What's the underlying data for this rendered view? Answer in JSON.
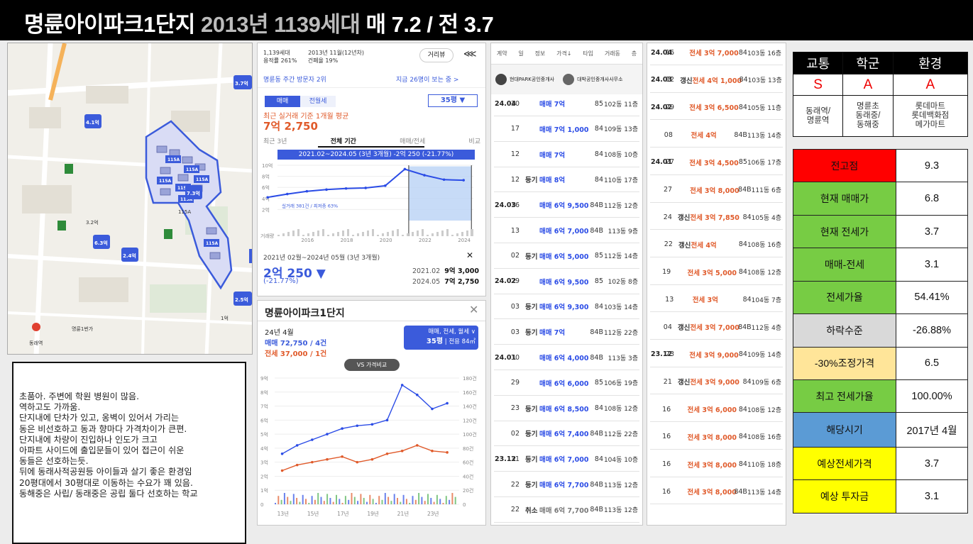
{
  "title": {
    "main": "명륜아이파크1단지",
    "sub": "2013년 1139세대",
    "rest": "매 7.2 / 전 3.7"
  },
  "map": {
    "labels": [
      "명륜1번가",
      "동래역",
      "3.2억",
      "6.3억",
      "4.1억",
      "1억",
      "2.4억",
      "115A",
      "7.3억",
      "3.7억",
      "2.5억"
    ],
    "unit_tags": [
      "115A",
      "115A",
      "115A",
      "115A",
      "115A",
      "115A",
      "115A"
    ]
  },
  "memo": [
    "초품아. 주변에 학원 병원이 많음.",
    "역하고도 가까움.",
    "단지내에 단차가 있고, 옹벽이 있어서 가리는",
    "동은 비선호하고 동과 향마다 가격차이가 큰편.",
    "단지내에 차량이 진입하나 인도가 크고",
    "아파트 사이드에 출입문들이 있어 접근이 쉬운",
    "동들은 선호하는듯.",
    "뒤에 동래사적공원등 아이들과 살기 좋은 환경임",
    "20평대에서 30평대로 이동하는 수요가 꽤 있음.",
    "동해중은 사립/ 동래중은 공립 둘다 선호하는 학교"
  ],
  "p1": {
    "households": "1,139세대",
    "built": "2013년 11월(12년차)",
    "far": "용적률 261%",
    "bcr": "건폐율 19%",
    "street_btn": "거리뷰",
    "visitor_rank": "명륜동 주간 방문자 2위",
    "viewers": "지금 26명이 보는 중 >",
    "tab_sale": "매매",
    "tab_jeonse": "전월세",
    "pyeong": "35평 ▼",
    "basis": "최근 실거래 기준 1개월 평균",
    "avg_price": "7억 2,750",
    "range_tabs": [
      "최근 3년",
      "전체 기간",
      "매매/전세",
      "비교"
    ],
    "banner": "2021.02~2024.05 (3년 3개월) -2억 250 (-21.77%)",
    "count_note": "실거래 381건 / 최저층 63%",
    "y_ticks": [
      "10억",
      "8억",
      "6억",
      "4억",
      "2억",
      "거래량"
    ],
    "x_ticks": [
      "2016",
      "2018",
      "2020",
      "2022",
      "2024"
    ],
    "period": "2021년 02월~2024년 05월 (3년 3개월)",
    "close_x": "✕",
    "change": "2억 250 ▼",
    "change_pct": "(-21.77%)",
    "start_date": "2021.02",
    "start_price": "9억 3,000",
    "end_date": "2024.05",
    "end_price": "7억 2,750"
  },
  "p2": {
    "name": "명륜아이파크1단지",
    "close": "✕",
    "month": "24년 4월",
    "sale_line": "매매 72,750 / 4건",
    "jeonse_line": "전세 37,000 / 1건",
    "filter1": "매매, 전세, 월세 ∨",
    "filter2": "35평",
    "filter3": "전용 84㎡",
    "vs": "VS 가격비교",
    "y_left": [
      "9억",
      "8억",
      "7억",
      "6억",
      "5억",
      "4억",
      "3억",
      "2억",
      "1억",
      "0"
    ],
    "y_right": [
      "180건",
      "160건",
      "140건",
      "120건",
      "100건",
      "80건",
      "60건",
      "40건",
      "20건",
      "0"
    ],
    "x_ticks": [
      "13년",
      "15년",
      "17년",
      "19년",
      "21년",
      "23년"
    ]
  },
  "tbl1": {
    "header": [
      "계약",
      "일",
      "정보",
      "가격↓",
      "타입",
      "거래동",
      "층"
    ],
    "agents": [
      "현대PARK공인중개사",
      "대박공인중개사사무소"
    ],
    "rows": [
      {
        "d": "24.04",
        "day": "30",
        "tag": "",
        "type": "sale",
        "price": "매매 7억",
        "area": "85",
        "unit": "102동 11층"
      },
      {
        "d": "",
        "day": "17",
        "tag": "",
        "type": "sale",
        "price": "매매 7억 1,000",
        "area": "84",
        "unit": "109동 13층"
      },
      {
        "d": "",
        "day": "12",
        "tag": "",
        "type": "sale",
        "price": "매매 7억",
        "area": "84",
        "unit": "108동 10층"
      },
      {
        "d": "",
        "day": "12",
        "tag": "등기",
        "type": "sale",
        "price": "매매 8억",
        "area": "84",
        "unit": "110동 17층"
      },
      {
        "d": "24.03",
        "day": "16",
        "tag": "",
        "type": "sale",
        "price": "매매 6억 9,500",
        "area": "84B",
        "unit": "112동 12층"
      },
      {
        "d": "",
        "day": "13",
        "tag": "",
        "type": "sale",
        "price": "매매 6억 7,000",
        "area": "84B",
        "unit": "113동 9층"
      },
      {
        "d": "",
        "day": "02",
        "tag": "등기",
        "type": "sale",
        "price": "매매 6억 5,000",
        "area": "85",
        "unit": "112동 14층"
      },
      {
        "d": "24.02",
        "day": "29",
        "tag": "",
        "type": "sale",
        "price": "매매 6억 9,500",
        "area": "85",
        "unit": "102동 8층"
      },
      {
        "d": "",
        "day": "03",
        "tag": "등기",
        "type": "sale",
        "price": "매매 6억 9,300",
        "area": "84",
        "unit": "103동 14층"
      },
      {
        "d": "",
        "day": "03",
        "tag": "등기",
        "type": "sale",
        "price": "매매 7억",
        "area": "84B",
        "unit": "112동 22층"
      },
      {
        "d": "24.01",
        "day": "30",
        "tag": "",
        "type": "sale",
        "price": "매매 6억 4,000",
        "area": "84B",
        "unit": "113동 3층"
      },
      {
        "d": "",
        "day": "29",
        "tag": "",
        "type": "sale",
        "price": "매매 6억 6,000",
        "area": "85",
        "unit": "106동 19층"
      },
      {
        "d": "",
        "day": "23",
        "tag": "등기",
        "type": "sale",
        "price": "매매 6억 8,500",
        "area": "84",
        "unit": "108동 12층"
      },
      {
        "d": "",
        "day": "02",
        "tag": "등기",
        "type": "sale",
        "price": "매매 6억 7,400",
        "area": "84B",
        "unit": "112동 22층"
      },
      {
        "d": "23.12",
        "day": "31",
        "tag": "등기",
        "type": "sale",
        "price": "매매 6억 7,000",
        "area": "84",
        "unit": "104동 10층"
      },
      {
        "d": "",
        "day": "22",
        "tag": "등기",
        "type": "sale",
        "price": "매매 6억 7,700",
        "area": "84B",
        "unit": "113동 12층"
      },
      {
        "d": "",
        "day": "22",
        "tag": "취소",
        "type": "cancel",
        "price": "매매 6억 7,700",
        "area": "84B",
        "unit": "113동 12층"
      }
    ]
  },
  "tbl2": {
    "rows": [
      {
        "d": "24.04",
        "day": "16",
        "tag": "",
        "price": "전세 3억 7,000",
        "area": "84",
        "unit": "103동 16층"
      },
      {
        "d": "24.03",
        "day": "12",
        "tag": "갱신",
        "price": "전세 4억 1,000",
        "area": "84",
        "unit": "103동 13층"
      },
      {
        "d": "24.02",
        "day": "29",
        "tag": "",
        "price": "전세 3억 6,500",
        "area": "84",
        "unit": "105동 11층"
      },
      {
        "d": "",
        "day": "08",
        "tag": "",
        "price": "전세 4억",
        "area": "84B",
        "unit": "113동 14층"
      },
      {
        "d": "24.01",
        "day": "27",
        "tag": "",
        "price": "전세 3억 4,500",
        "area": "85",
        "unit": "106동 17층"
      },
      {
        "d": "",
        "day": "27",
        "tag": "",
        "price": "전세 3억 8,000",
        "area": "84B",
        "unit": "111동 6층"
      },
      {
        "d": "",
        "day": "24",
        "tag": "갱신",
        "price": "전세 3억 7,850",
        "area": "84",
        "unit": "105동 4층"
      },
      {
        "d": "",
        "day": "22",
        "tag": "갱신",
        "price": "전세 4억",
        "area": "84",
        "unit": "108동 16층"
      },
      {
        "d": "",
        "day": "19",
        "tag": "",
        "price": "전세 3억 5,000",
        "area": "84",
        "unit": "108동 12층"
      },
      {
        "d": "",
        "day": "13",
        "tag": "",
        "price": "전세 3억",
        "area": "84",
        "unit": "104동 7층"
      },
      {
        "d": "",
        "day": "04",
        "tag": "갱신",
        "price": "전세 3억 7,000",
        "area": "84B",
        "unit": "112동 4층"
      },
      {
        "d": "23.12",
        "day": "23",
        "tag": "",
        "price": "전세 3억 9,000",
        "area": "84",
        "unit": "109동 14층"
      },
      {
        "d": "",
        "day": "21",
        "tag": "갱신",
        "price": "전세 3억 9,000",
        "area": "84",
        "unit": "109동 6층"
      },
      {
        "d": "",
        "day": "16",
        "tag": "",
        "price": "전세 3억 6,000",
        "area": "84",
        "unit": "108동 12층"
      },
      {
        "d": "",
        "day": "16",
        "tag": "",
        "price": "전세 3억 8,000",
        "area": "84",
        "unit": "108동 16층"
      },
      {
        "d": "",
        "day": "16",
        "tag": "",
        "price": "전세 3억 8,000",
        "area": "84",
        "unit": "110동 18층"
      },
      {
        "d": "",
        "day": "16",
        "tag": "",
        "price": "전세 3억 8,000",
        "area": "84B",
        "unit": "113동 14층"
      }
    ]
  },
  "env": {
    "headers": [
      "교통",
      "학군",
      "환경"
    ],
    "grades": [
      "S",
      "A",
      "A"
    ],
    "details": [
      [
        "동래역/",
        "명륜역"
      ],
      [
        "명륜초",
        "동래중/",
        "동해중"
      ],
      [
        "롯데마트",
        "롯데백화점",
        "메가마트"
      ]
    ]
  },
  "kpi": [
    {
      "label": "전고점",
      "value": "9.3",
      "color": "#ff0000"
    },
    {
      "label": "현재 매매가",
      "value": "6.8",
      "color": "#77cc44"
    },
    {
      "label": "현재 전세가",
      "value": "3.7",
      "color": "#77cc44"
    },
    {
      "label": "매매-전세",
      "value": "3.1",
      "color": "#77cc44"
    },
    {
      "label": "전세가율",
      "value": "54.41%",
      "color": "#77cc44"
    },
    {
      "label": "하락수준",
      "value": "-26.88%",
      "color": "#d9d9d9"
    },
    {
      "label": "-30%조정가격",
      "value": "6.5",
      "color": "#ffe599"
    },
    {
      "label": "최고 전세가율",
      "value": "100.00%",
      "color": "#77cc44"
    },
    {
      "label": "해당시기",
      "value": "2017년 4월",
      "color": "#5b9bd5"
    },
    {
      "label": "예상전세가격",
      "value": "3.7",
      "color": "#ffff00"
    },
    {
      "label": "예상 투자금",
      "value": "3.1",
      "color": "#ffff00"
    }
  ],
  "colors": {
    "sale": "#2b4ce6",
    "jeonse": "#e05a2a",
    "accent": "#3b5bdb",
    "header": "#000000"
  },
  "icons": [
    "share-icon",
    "close-icon",
    "agent-avatar-icon",
    "building-icon",
    "map-pin-icon"
  ],
  "chart_data": [
    {
      "type": "line",
      "title": "",
      "xlabel": "",
      "ylabel": "",
      "x": [
        2014,
        2015,
        2016,
        2017,
        2018,
        2019,
        2020,
        2021,
        2022,
        2023,
        2024
      ],
      "series": [
        {
          "values": [
            4.2,
            4.8,
            5.3,
            5.6,
            5.8,
            5.9,
            6.3,
            9.3,
            8.2,
            7.4,
            7.3
          ]
        }
      ],
      "ylim": [
        0,
        10
      ],
      "unit": "억"
    },
    {
      "type": "line",
      "title": "",
      "x": [
        2013,
        2014,
        2015,
        2016,
        2017,
        2018,
        2019,
        2020,
        2021,
        2022,
        2023,
        2024
      ],
      "series": [
        {
          "values": [
            3.6,
            4.2,
            4.6,
            5.0,
            5.4,
            5.6,
            5.7,
            6.0,
            8.5,
            7.8,
            6.8,
            7.2
          ]
        },
        {
          "values": [
            2.4,
            2.8,
            3.0,
            3.2,
            3.4,
            3.0,
            3.2,
            3.6,
            3.8,
            4.2,
            3.8,
            3.7
          ]
        }
      ],
      "ylim": [
        0,
        9
      ]
    }
  ]
}
